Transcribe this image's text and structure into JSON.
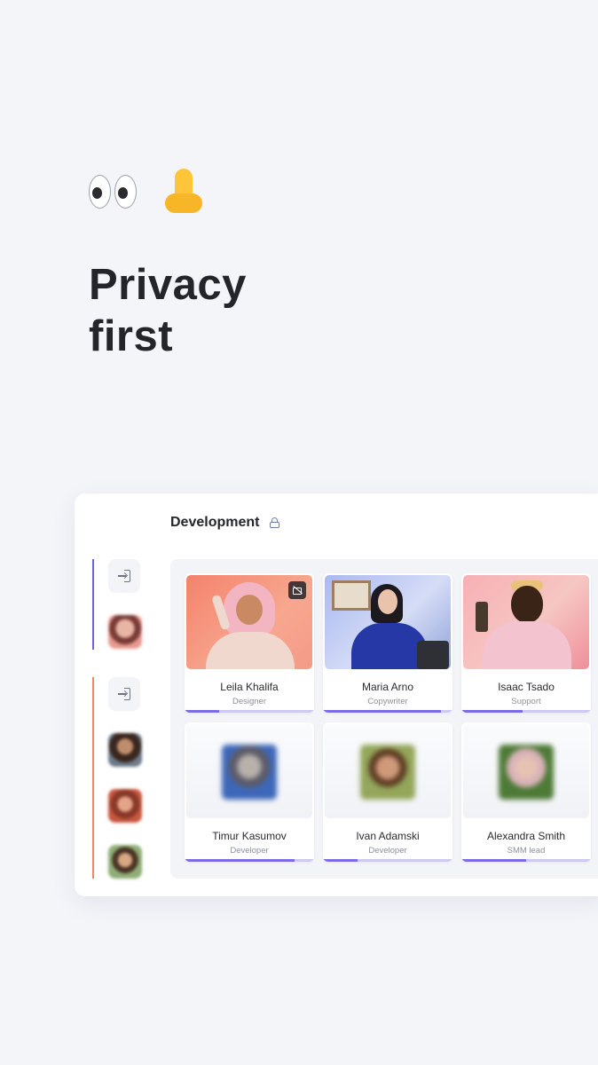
{
  "hero": {
    "emoji": {
      "eyes": "eyes-icon",
      "nose": "nose-icon"
    },
    "title_line1": "Privacy",
    "title_line2": "first"
  },
  "panel": {
    "title": "Development",
    "title_icon": "lock-open-icon",
    "sidebar": {
      "groups": [
        {
          "accent": "#6c63e6",
          "button_icon": "enter-icon",
          "avatars": 1
        },
        {
          "accent": "#ee8a63",
          "button_icon": "enter-icon",
          "avatars": 3
        }
      ]
    },
    "participants": [
      {
        "name": "Leila Khalifa",
        "role": "Designer",
        "video": true,
        "cam_off_icon": true,
        "progress": 0.27
      },
      {
        "name": "Maria Arno",
        "role": "Copywriter",
        "video": true,
        "progress": 0.91
      },
      {
        "name": "Isaac Tsado",
        "role": "Support",
        "video": true,
        "progress": 0.47
      },
      {
        "name": "Timur Kasumov",
        "role": "Developer",
        "video": false,
        "progress": 0.85
      },
      {
        "name": "Ivan Adamski",
        "role": "Developer",
        "video": false,
        "progress": 0.27
      },
      {
        "name": "Alexandra Smith",
        "role": "SMM lead",
        "video": false,
        "progress": 0.5
      }
    ]
  },
  "colors": {
    "background": "#f4f5f9",
    "accent_purple": "#7b6be8",
    "accent_orange": "#ee8a63",
    "progress_track": "#cdc8f4"
  }
}
